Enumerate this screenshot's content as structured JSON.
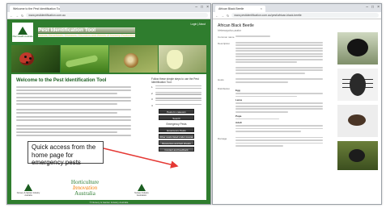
{
  "left_browser": {
    "tab_title": "Welcome to the Pest Identification Tool",
    "url": "www.pestidentification.com.au",
    "site": {
      "org_logo_text": "Plant Health Australia",
      "title": "Pest Identification Tool",
      "subtitle": "Insects, Beneficials, Diseases, Disorders and Weeds of Nursery Production",
      "header_links": "Login | About",
      "welcome_heading": "Welcome to the Pest Identification Tool",
      "side_heading": "Follow these simple steps to use the Pest Identification Tool:",
      "side_steps": [
        "1",
        "2",
        "3",
        "4"
      ],
      "buttons": [
        "Pests by category",
        "Search",
        "Emergency Pests",
        "Other pests listed under quarantine",
        "Resources and fact sheets",
        "Contact and feedback"
      ],
      "mid_label": "Emergency Pests",
      "logos": {
        "left_caption": "Nursery & Garden Industry Australia",
        "hia_line1": "Horticulture",
        "hia_line2": "Innovation",
        "hia_line3": "Australia",
        "right_caption": "Nursery Industry Association"
      },
      "footer": "© Nursery & Garden Industry Australia"
    }
  },
  "callout": {
    "text": "Quick access from the home page for emergency pests"
  },
  "right_browser": {
    "tab_title": "African Black Beetle",
    "url": "www.pestidentification.com.au/pest/african-black-beetle",
    "page_title": "African Black Beetle",
    "scientific_name": "Heteronychus arator",
    "labels": [
      "Common name",
      "Description",
      "Hosts",
      "Distribution",
      "Damage"
    ],
    "keys": [
      "Egg",
      "Larva",
      "Pupa",
      "Adult"
    ]
  },
  "colors": {
    "site_green": "#2f7d2e",
    "hia_orange": "#f57c00",
    "callout_arrow": "#e53935"
  }
}
